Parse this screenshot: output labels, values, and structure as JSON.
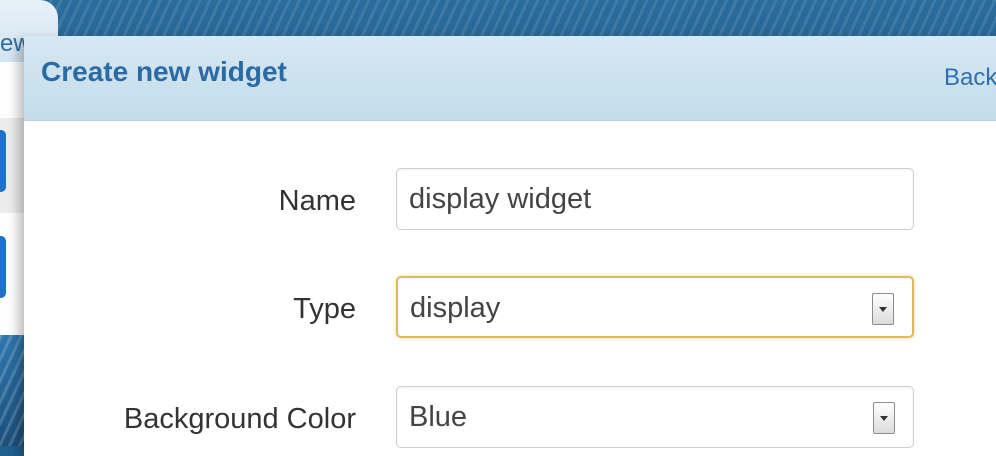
{
  "left_panel": {
    "tab_label_fragment": "ew"
  },
  "dialog": {
    "title": "Create new widget",
    "back_label": "Back"
  },
  "form": {
    "name": {
      "label": "Name",
      "value": "display widget"
    },
    "type": {
      "label": "Type",
      "value": "display"
    },
    "background_color": {
      "label": "Background Color",
      "value": "Blue"
    }
  }
}
